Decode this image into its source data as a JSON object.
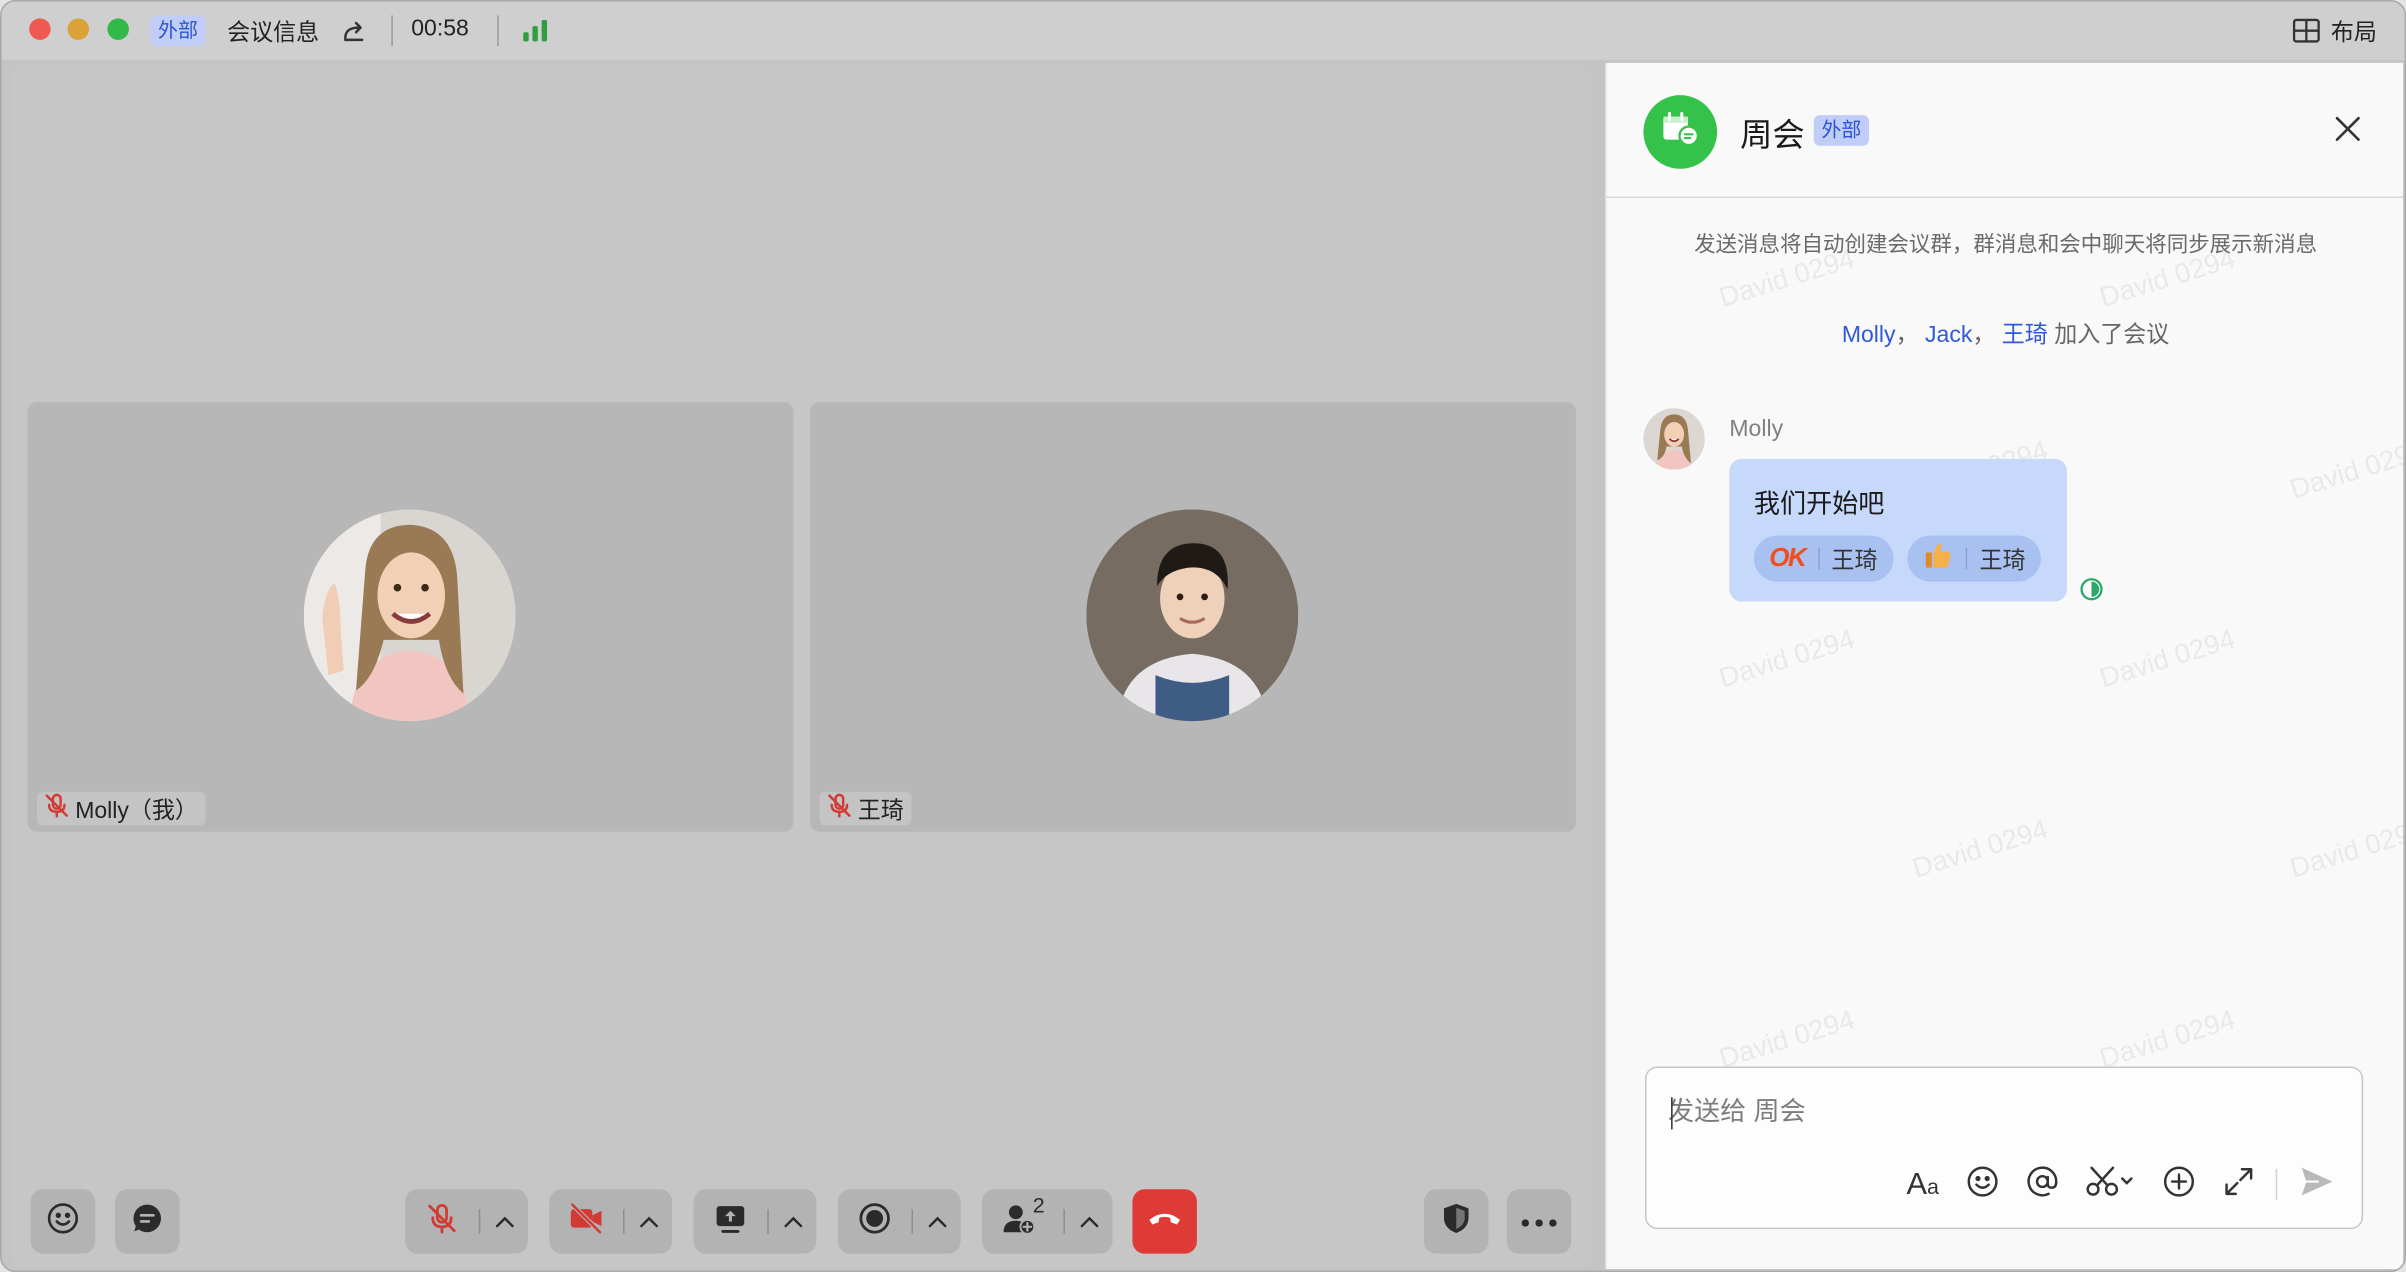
{
  "titlebar": {
    "external_tag": "外部",
    "meeting_info": "会议信息",
    "timer": "00:58",
    "layout_label": "布局"
  },
  "participants": [
    {
      "name": "Molly（我）"
    },
    {
      "name": "王琦"
    }
  ],
  "controls": {
    "participant_count": "2"
  },
  "chat": {
    "title": "周会",
    "external_tag": "外部",
    "notice": "发送消息将自动创建会议群，群消息和会中聊天将同步展示新消息",
    "joined": {
      "names": [
        "Molly",
        "Jack",
        "王琦"
      ],
      "separator": "，",
      "suffix": " 加入了会议"
    },
    "message": {
      "sender": "Molly",
      "text": "我们开始吧",
      "reactions": [
        {
          "emoji": "OK",
          "user": "王琦"
        },
        {
          "emoji": "thumbs-up",
          "user": "王琦"
        }
      ]
    },
    "input_placeholder": "发送给 周会",
    "watermark": "David 0294"
  },
  "colors": {
    "accent_blue": "#2f59d6",
    "bubble": "#c7d9fb",
    "end_call_red": "#de3b36",
    "group_green": "#34c24a",
    "tag_bg": "#c0cdf6"
  }
}
